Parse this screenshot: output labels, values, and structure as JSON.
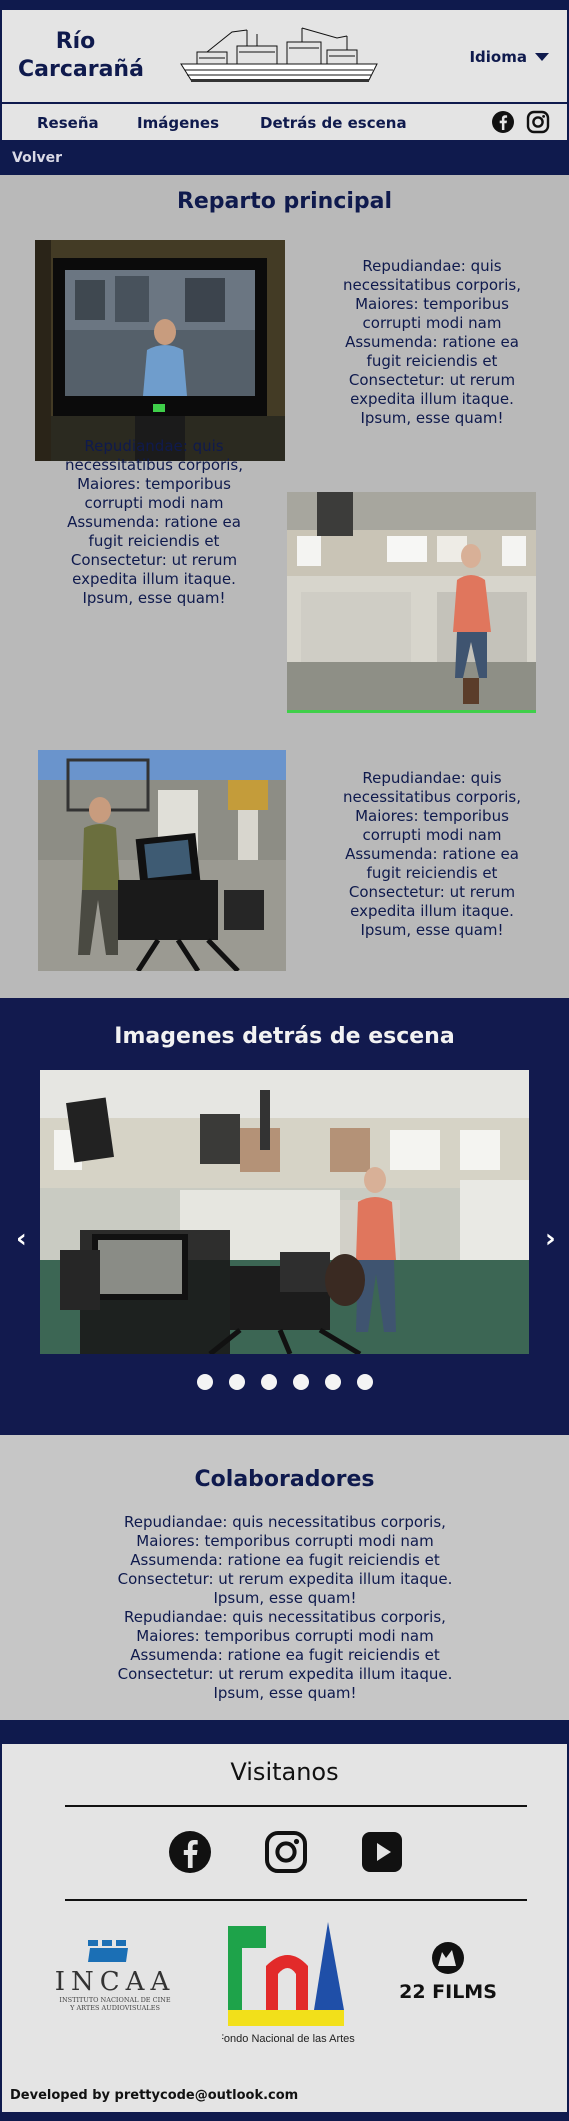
{
  "header": {
    "brand_line1": "Río",
    "brand_line2": "Carcarañá",
    "language_label": "Idioma"
  },
  "nav": {
    "tabs": [
      "Reseña",
      "Imágenes",
      "Detrás de escena"
    ]
  },
  "back_label": "Volver",
  "cast": {
    "title": "Reparto principal",
    "entries": [
      {
        "text": "Repudiandae: quis necessitatibus corporis, Maiores: temporibus corrupti modi nam Assumenda: ratione ea fugit reiciendis et Consectetur: ut rerum expedita illum itaque. Ipsum, esse quam!"
      },
      {
        "text": "Repudiandae: quis necessitatibus corporis, Maiores: temporibus corrupti modi nam Assumenda: ratione ea fugit reiciendis et Consectetur: ut rerum expedita illum itaque. Ipsum, esse quam!"
      },
      {
        "text": "Repudiandae: quis necessitatibus corporis, Maiores: temporibus corrupti modi nam Assumenda: ratione ea fugit reiciendis et Consectetur: ut rerum expedita illum itaque. Ipsum, esse quam!"
      }
    ]
  },
  "gallery": {
    "title": "Imagenes detrás de escena",
    "slide_count": 6,
    "active_slide": 1
  },
  "collab": {
    "title": "Colaboradores",
    "paragraph1": "Repudiandae: quis necessitatibus corporis, Maiores: temporibus corrupti modi nam Assumenda: ratione ea fugit reiciendis et Consectetur: ut rerum expedita illum itaque. Ipsum, esse quam!",
    "paragraph2": "Repudiandae: quis necessitatibus corporis, Maiores: temporibus corrupti modi nam Assumenda: ratione ea fugit reiciendis et Consectetur: ut rerum expedita illum itaque. Ipsum, esse quam!"
  },
  "footer": {
    "visit_title": "Visitanos",
    "social_icons": [
      "facebook-icon",
      "instagram-icon",
      "youtube-icon"
    ],
    "partners": {
      "incaa_name": "INCAA",
      "incaa_sub1": "INSTITUTO NACIONAL DE CINE",
      "incaa_sub2": "Y ARTES AUDIOVISUALES",
      "fna_caption": "Fondo Nacional de las Artes",
      "films_name": "22 FILMS"
    },
    "developer_credit": "Developed by prettycode@outlook.com"
  },
  "colors": {
    "navy": "#0f1a4d",
    "light_panel": "#e4e4e4",
    "cast_bg": "#b9b9b9",
    "collab_bg": "#c6c6c6"
  }
}
